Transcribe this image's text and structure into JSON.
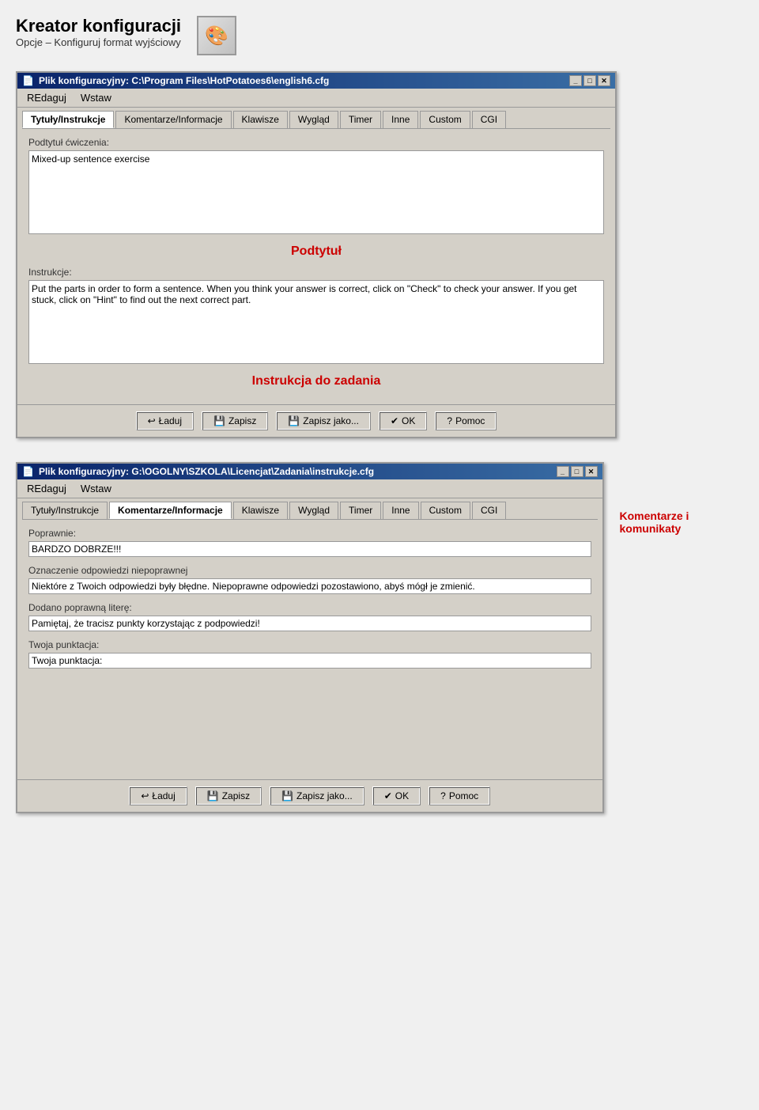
{
  "pageHeader": {
    "title": "Kreator konfiguracji",
    "subtitle": "Opcje – Konfiguruj format wyjściowy"
  },
  "window1": {
    "titlebar": "Plik konfiguracyjny: C:\\Program Files\\HotPotatoes6\\english6.cfg",
    "menuItems": [
      "REdaguj",
      "Wstaw"
    ],
    "tabs": [
      "Tytuły/Instrukcje",
      "Komentarze/Informacje",
      "Klawisze",
      "Wygląd",
      "Timer",
      "Inne",
      "Custom",
      "CGI"
    ],
    "activeTab": 0,
    "fields": {
      "subtitle": {
        "label": "Podtytuł ćwiczenia:",
        "value": "Mixed-up sentence exercise",
        "annotation": "Podtytuł"
      },
      "instructions": {
        "label": "Instrukcje:",
        "value": "Put the parts in order to form a sentence. When you think your answer is correct, click on \"Check\" to check your answer. If you get stuck, click on \"Hint\" to find out the next correct part.",
        "annotation": "Instrukcja do zadania"
      }
    },
    "buttons": {
      "load": "Ładuj",
      "save": "Zapisz",
      "saveAs": "Zapisz jako...",
      "ok": "OK",
      "help": "Pomoc"
    }
  },
  "window2": {
    "titlebar": "Plik konfiguracyjny: G:\\OGOLNY\\SZKOLA\\Licencjat\\Zadania\\instrukcje.cfg",
    "menuItems": [
      "REdaguj",
      "Wstaw"
    ],
    "tabs": [
      "Tytuły/Instrukcje",
      "Komentarze/Informacje",
      "Klawisze",
      "Wygląd",
      "Timer",
      "Inne",
      "Custom",
      "CGI"
    ],
    "activeTab": 1,
    "fields": {
      "correct": {
        "label": "Poprawnie:",
        "value": "BARDZO DOBRZE!!!"
      },
      "incorrect": {
        "label": "Oznaczenie odpowiedzi niepoprawnej",
        "value": "Niektóre z Twoich odpowiedzi były błędne. Niepoprawne odpowiedzi pozostawiono, abyś mógł je zmienić."
      },
      "hint": {
        "label": "Dodano poprawną literę:",
        "value": "Pamiętaj, że tracisz punkty korzystając z podpowiedzi!"
      },
      "score": {
        "label": "Twoja punktacja:",
        "value": "Twoja punktacja:"
      }
    },
    "buttons": {
      "load": "Ładuj",
      "save": "Zapisz",
      "saveAs": "Zapisz jako...",
      "ok": "OK",
      "help": "Pomoc"
    },
    "sideAnnotation": "Komentarze i komunikaty"
  }
}
